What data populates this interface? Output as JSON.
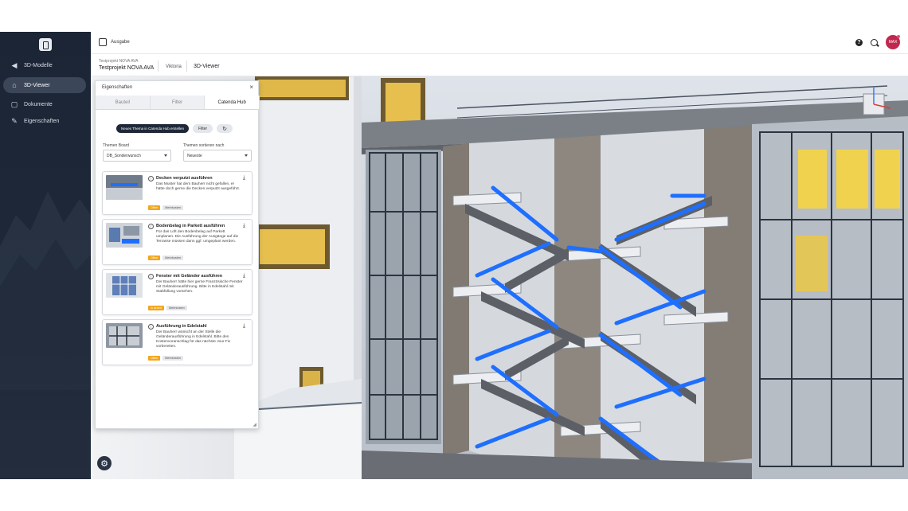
{
  "sidebar": {
    "items": [
      {
        "label": "3D-Modelle",
        "icon": "back-arrow-icon"
      },
      {
        "label": "3D-Viewer",
        "icon": "home-icon"
      },
      {
        "label": "Dokumente",
        "icon": "document-icon"
      },
      {
        "label": "Eigenschaften",
        "icon": "pencil-icon"
      }
    ]
  },
  "topbar": {
    "section_label": "Ausgabe"
  },
  "avatar": {
    "initials": "MAX"
  },
  "breadcrumb": {
    "project_small": "Testprojekt NOVA AVA",
    "project": "Testprojekt NOVA AVA",
    "item1": "Viktoria",
    "current": "3D-Viewer"
  },
  "panel": {
    "title": "Eigenschaften",
    "close": "×",
    "tabs": [
      "Bauteil",
      "Filter",
      "Catenda Hub"
    ],
    "new_topic_button": "Neues Thema in Catenda Hub erstellen",
    "filter_button": "Filter",
    "refresh_glyph": "↻",
    "board_label": "Themen Board",
    "board_value": "DB_Sonderwunsch",
    "sort_label": "Themen sortieren nach",
    "sort_value": "Neueste",
    "cards": [
      {
        "title": "Decken verputzt ausführen",
        "desc": "Das Muster hat dem Bauherr nicht gefallen, er hätte doch gerne die Decken verputzt ausgeführt.",
        "badge1": "Offen",
        "badge2": "Mehrkosten"
      },
      {
        "title": "Bodenbelag in Parkett ausführen",
        "desc": "Für das Loft den Bodenbelag auf Parkett umplanen. Die Ausführung der Ausgänge auf die Terrasse müssen dann ggf. umgeplant werden.",
        "badge1": "Offen",
        "badge2": "Mehrkosten"
      },
      {
        "title": "Fenster mit Geländer ausführen",
        "desc": "Der Bauherr hätte hier gerne Französische Fenster mit Geländerausführung. Bitte in Edelstahl mit Stabfüllung vorsehen.",
        "badge1": "In Arbeit",
        "badge2": "Mehrkosten"
      },
      {
        "title": "Ausführung in Edelstahl",
        "desc": "Der Bauherr wünscht an der Stelle die Geländerausführung in Edelstahl. Bitte den Kostenvoranschlag für das nächste Jour Fix vorbereiten.",
        "badge1": "Offen",
        "badge2": "Mehrkosten"
      }
    ]
  },
  "colors": {
    "sidebar_bg": "#1b2535",
    "accent_dark": "#1e2838",
    "badge_orange": "#f2a51a",
    "stair_blue": "#1f6fff",
    "avatar": "#c2274f"
  }
}
